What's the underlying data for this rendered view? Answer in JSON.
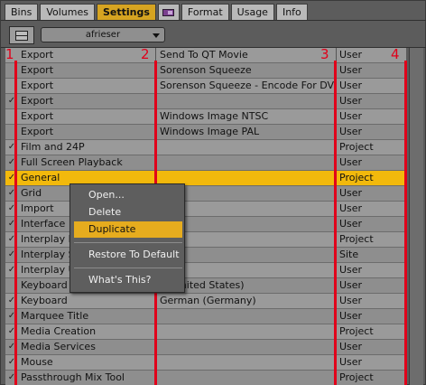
{
  "tabs": [
    {
      "label": "Bins",
      "active": false
    },
    {
      "label": "Volumes",
      "active": false
    },
    {
      "label": "Settings",
      "active": true
    },
    {
      "label": "",
      "active": false,
      "icon": "purple-monitor-icon"
    },
    {
      "label": "Format",
      "active": false
    },
    {
      "label": "Usage",
      "active": false
    },
    {
      "label": "Info",
      "active": false
    }
  ],
  "toolbar": {
    "fast_menu_icon": "fast-menu-icon",
    "user_select_value": "afrieser"
  },
  "rows": [
    {
      "checked": false,
      "kind": "Export",
      "name": "Send To QT Movie",
      "scope": "User"
    },
    {
      "checked": false,
      "kind": "Export",
      "name": "Sorenson Squeeze",
      "scope": "User"
    },
    {
      "checked": false,
      "kind": "Export",
      "name": "Sorenson Squeeze - Encode For DVD",
      "scope": "User"
    },
    {
      "checked": true,
      "kind": "Export",
      "name": "",
      "scope": "User"
    },
    {
      "checked": false,
      "kind": "Export",
      "name": "Windows Image NTSC",
      "scope": "User"
    },
    {
      "checked": false,
      "kind": "Export",
      "name": "Windows Image PAL",
      "scope": "User"
    },
    {
      "checked": true,
      "kind": "Film and 24P",
      "name": "",
      "scope": "Project"
    },
    {
      "checked": true,
      "kind": "Full Screen Playback",
      "name": "",
      "scope": "User"
    },
    {
      "checked": true,
      "kind": "General",
      "name": "",
      "scope": "Project",
      "selected": true
    },
    {
      "checked": true,
      "kind": "Grid",
      "name": "",
      "scope": "User"
    },
    {
      "checked": true,
      "kind": "Import",
      "name": "",
      "scope": "User"
    },
    {
      "checked": true,
      "kind": "Interface",
      "name": "",
      "scope": "User"
    },
    {
      "checked": true,
      "kind": "Interplay Fo",
      "name": "",
      "scope": "Project"
    },
    {
      "checked": true,
      "kind": "Interplay Se",
      "name": "",
      "scope": "Site"
    },
    {
      "checked": true,
      "kind": "Interplay Us",
      "name": "",
      "scope": "User"
    },
    {
      "checked": false,
      "kind": "Keyboard",
      "name": "h (United States)",
      "scope": "User"
    },
    {
      "checked": true,
      "kind": "Keyboard",
      "name": "German (Germany)",
      "scope": "User"
    },
    {
      "checked": true,
      "kind": "Marquee Title",
      "name": "",
      "scope": "User"
    },
    {
      "checked": true,
      "kind": "Media Creation",
      "name": "",
      "scope": "Project"
    },
    {
      "checked": true,
      "kind": "Media Services",
      "name": "",
      "scope": "User"
    },
    {
      "checked": true,
      "kind": "Mouse",
      "name": "",
      "scope": "User"
    },
    {
      "checked": true,
      "kind": "Passthrough Mix Tool",
      "name": "",
      "scope": "Project"
    }
  ],
  "check_glyph": "✓",
  "markers": [
    "1",
    "2",
    "3",
    "4"
  ],
  "marker_color": "#e1001a",
  "context_menu": {
    "items": [
      {
        "label": "Open...",
        "highlight": false
      },
      {
        "label": "Delete",
        "highlight": false
      },
      {
        "label": "Duplicate",
        "highlight": true
      },
      {
        "label": "Restore To Default",
        "highlight": false
      },
      {
        "label": "What's This?",
        "highlight": false
      }
    ]
  },
  "colors": {
    "accent": "#d6a421",
    "selected_row": "#f2b90c",
    "menu_highlight": "#e6ac1e"
  }
}
